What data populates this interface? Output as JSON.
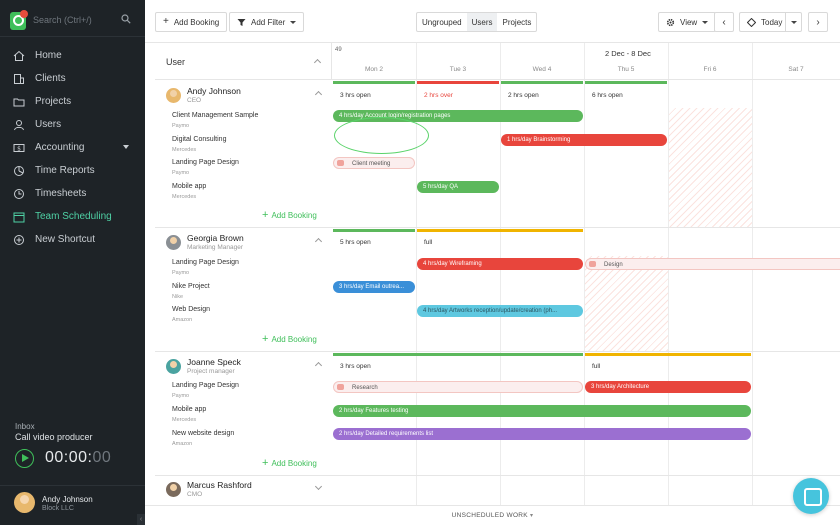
{
  "sidebar": {
    "search_placeholder": "Search (Ctrl+/)",
    "nav": [
      {
        "label": "Home",
        "icon": "home-icon"
      },
      {
        "label": "Clients",
        "icon": "building-icon"
      },
      {
        "label": "Projects",
        "icon": "folder-icon"
      },
      {
        "label": "Users",
        "icon": "user-icon"
      },
      {
        "label": "Accounting",
        "icon": "dollar-icon"
      },
      {
        "label": "Time Reports",
        "icon": "chart-icon"
      },
      {
        "label": "Timesheets",
        "icon": "clock-icon"
      },
      {
        "label": "Team Scheduling",
        "icon": "calendar-icon"
      },
      {
        "label": "New Shortcut",
        "icon": "plus-circle-icon"
      }
    ],
    "inbox_label": "Inbox",
    "inbox_task": "Call video producer",
    "timer_main": "00:00:",
    "timer_dim": "00",
    "user_name": "Andy Johnson",
    "user_company": "Block LLC",
    "accent": "#4fd1a5"
  },
  "toolbar": {
    "add_booking": "Add Booking",
    "add_filter": "Add Filter",
    "segments": [
      "Ungrouped",
      "Users",
      "Projects"
    ],
    "active_segment": "Users",
    "view": "View",
    "today": "Today"
  },
  "grid": {
    "column_label": "User",
    "week_number": "49",
    "range": "2 Dec - 8 Dec",
    "days": [
      "Mon 2",
      "Tue 3",
      "Wed 4",
      "Thu 5",
      "Fri 6",
      "Sat 7"
    ]
  },
  "people": [
    {
      "name": "Andy Johnson",
      "role": "CEO",
      "availability": [
        "3 hrs open",
        "2 hrs over",
        "2 hrs open",
        "6 hrs open"
      ],
      "projects": [
        {
          "name": "Client Management Sample",
          "client": "Paymo"
        },
        {
          "name": "Digital Consulting",
          "client": "Mercedes"
        },
        {
          "name": "Landing Page Design",
          "client": "Paymo"
        },
        {
          "name": "Mobile app",
          "client": "Mercedes"
        }
      ],
      "bookings": [
        "4 hrs/day Account login/registration pages",
        "1 hrs/day Brainstorming",
        "Client meeting",
        "5 hrs/day QA"
      ],
      "add_label": "Add Booking"
    },
    {
      "name": "Georgia Brown",
      "role": "Marketing Manager",
      "availability": [
        "5 hrs open",
        "full"
      ],
      "projects": [
        {
          "name": "Landing Page Design",
          "client": "Paymo"
        },
        {
          "name": "Nike Project",
          "client": "Nike"
        },
        {
          "name": "Web Design",
          "client": "Amazon"
        }
      ],
      "bookings": [
        "4 hrs/day Wireframing",
        "Design",
        "3 hrs/day Email outrea...",
        "4 hrs/day Artworks reception/update/creation (ph..."
      ],
      "add_label": "Add Booking"
    },
    {
      "name": "Joanne Speck",
      "role": "Project manager",
      "availability": [
        "3 hrs open",
        "full"
      ],
      "projects": [
        {
          "name": "Landing Page Design",
          "client": "Paymo"
        },
        {
          "name": "Mobile app",
          "client": "Mercedes"
        },
        {
          "name": "New website design",
          "client": "Amazon"
        }
      ],
      "bookings": [
        "Research",
        "3 hrs/day Architecture",
        "2 hrs/day Features testing",
        "2 hrs/day Detailed requirements list"
      ],
      "add_label": "Add Booking"
    },
    {
      "name": "Marcus Rashford",
      "role": "CMO"
    }
  ],
  "footer": {
    "unscheduled": "UNSCHEDULED WORK"
  },
  "colors": {
    "green": "#5cb85c",
    "red": "#e8453c",
    "yellow": "#f0b400",
    "blue": "#3a8fd8",
    "cyan": "#5ec8e0",
    "purple": "#9b6fd1"
  }
}
